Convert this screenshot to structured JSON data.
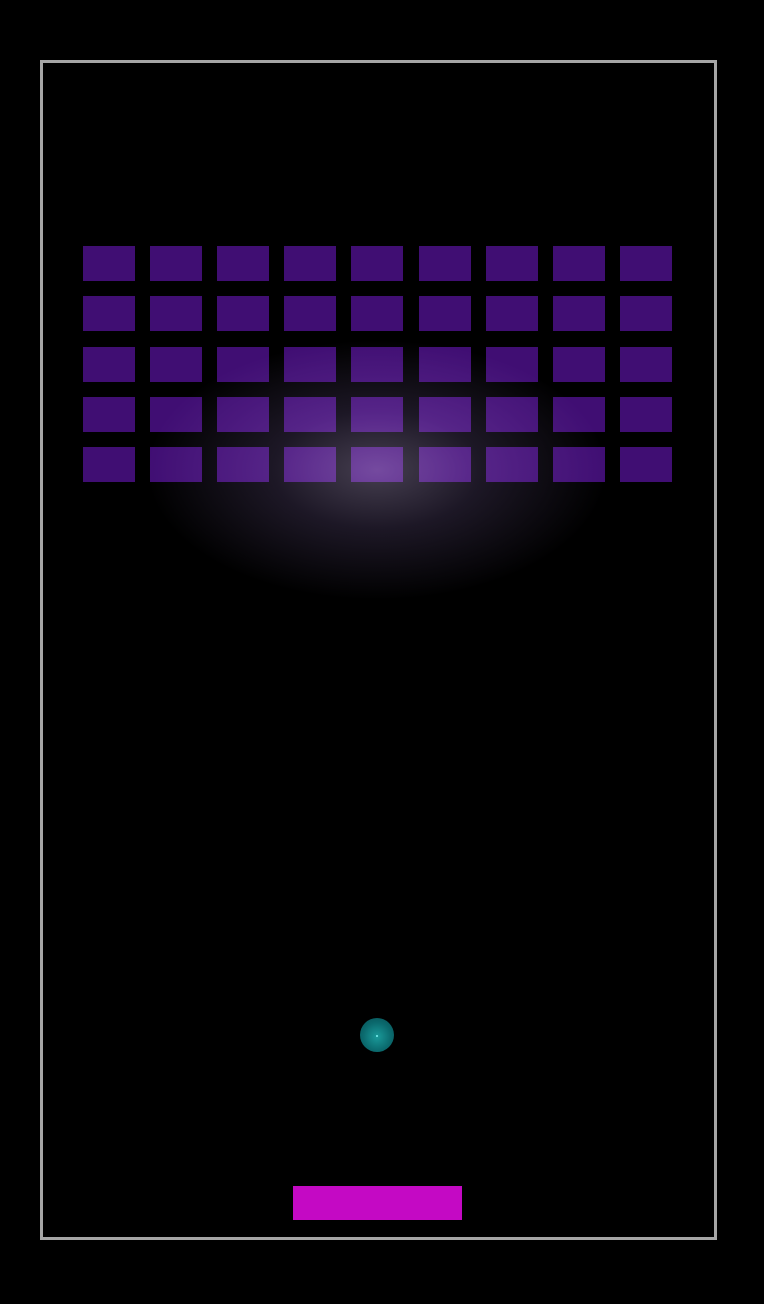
{
  "game": {
    "title": "",
    "colors": {
      "background": "#000000",
      "border": "#a6a6a6",
      "brick": "#400e73",
      "ball": "#0b6a6e",
      "paddle": "#c409c4"
    },
    "bricks": {
      "rows": 5,
      "columns": 9
    }
  }
}
